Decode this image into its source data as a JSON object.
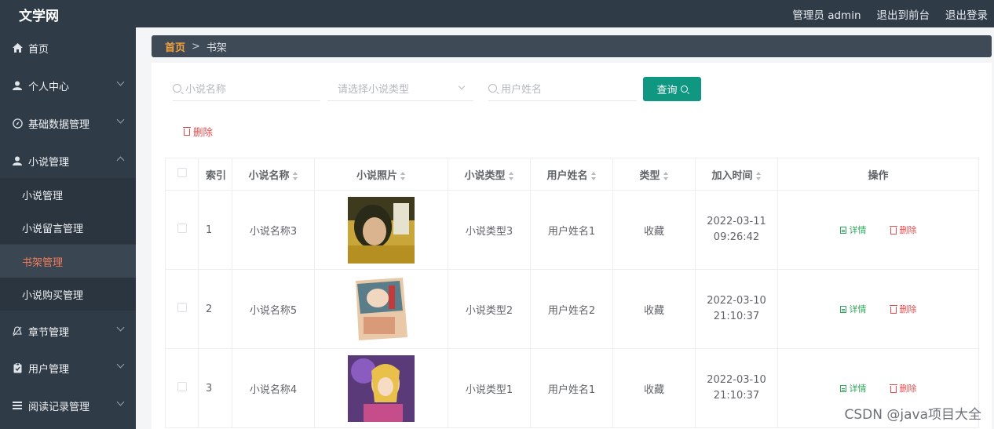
{
  "app": {
    "title": "文学网"
  },
  "topbar": {
    "admin": "管理员 admin",
    "to_front": "退出到前台",
    "logout": "退出登录"
  },
  "sidebar": {
    "items": [
      {
        "label": "首页",
        "icon": "home-icon"
      },
      {
        "label": "个人中心",
        "icon": "user-icon"
      },
      {
        "label": "基础数据管理",
        "icon": "compass-icon"
      },
      {
        "label": "小说管理",
        "icon": "user-icon"
      },
      {
        "label": "章节管理",
        "icon": "bell-icon"
      },
      {
        "label": "用户管理",
        "icon": "clipboard-icon"
      },
      {
        "label": "阅读记录管理",
        "icon": "list-icon"
      }
    ],
    "sub_items": [
      {
        "label": "小说管理"
      },
      {
        "label": "小说留言管理"
      },
      {
        "label": "书架管理"
      },
      {
        "label": "小说购买管理"
      }
    ]
  },
  "breadcrumb": {
    "home": "首页",
    "separator": ">",
    "current": "书架"
  },
  "filters": {
    "novel_name_placeholder": "小说名称",
    "novel_type_placeholder": "请选择小说类型",
    "user_name_placeholder": "用户姓名",
    "search_label": "查询"
  },
  "actions": {
    "delete_label": "删除"
  },
  "table": {
    "headers": {
      "index": "索引",
      "name": "小说名称",
      "photo": "小说照片",
      "novel_type": "小说类型",
      "user": "用户姓名",
      "type": "类型",
      "time": "加入时间",
      "ops": "操作"
    },
    "rows": [
      {
        "index": "1",
        "name": "小说名称3",
        "novel_type": "小说类型3",
        "user": "用户姓名1",
        "type": "收藏",
        "time": "2022-03-11 09:26:42"
      },
      {
        "index": "2",
        "name": "小说名称5",
        "novel_type": "小说类型2",
        "user": "用户姓名2",
        "type": "收藏",
        "time": "2022-03-10 21:10:37"
      },
      {
        "index": "3",
        "name": "小说名称4",
        "novel_type": "小说类型1",
        "user": "用户姓名1",
        "type": "收藏",
        "time": "2022-03-10 21:10:37"
      }
    ],
    "op_detail": "详情",
    "op_delete": "删除"
  },
  "watermark": "CSDN @java项目大全",
  "colors": {
    "sidebar_bg": "#2f3b47",
    "accent": "#0f9781",
    "active_menu": "#f07c5c",
    "danger": "#e24c4c",
    "success": "#2ea85a"
  }
}
